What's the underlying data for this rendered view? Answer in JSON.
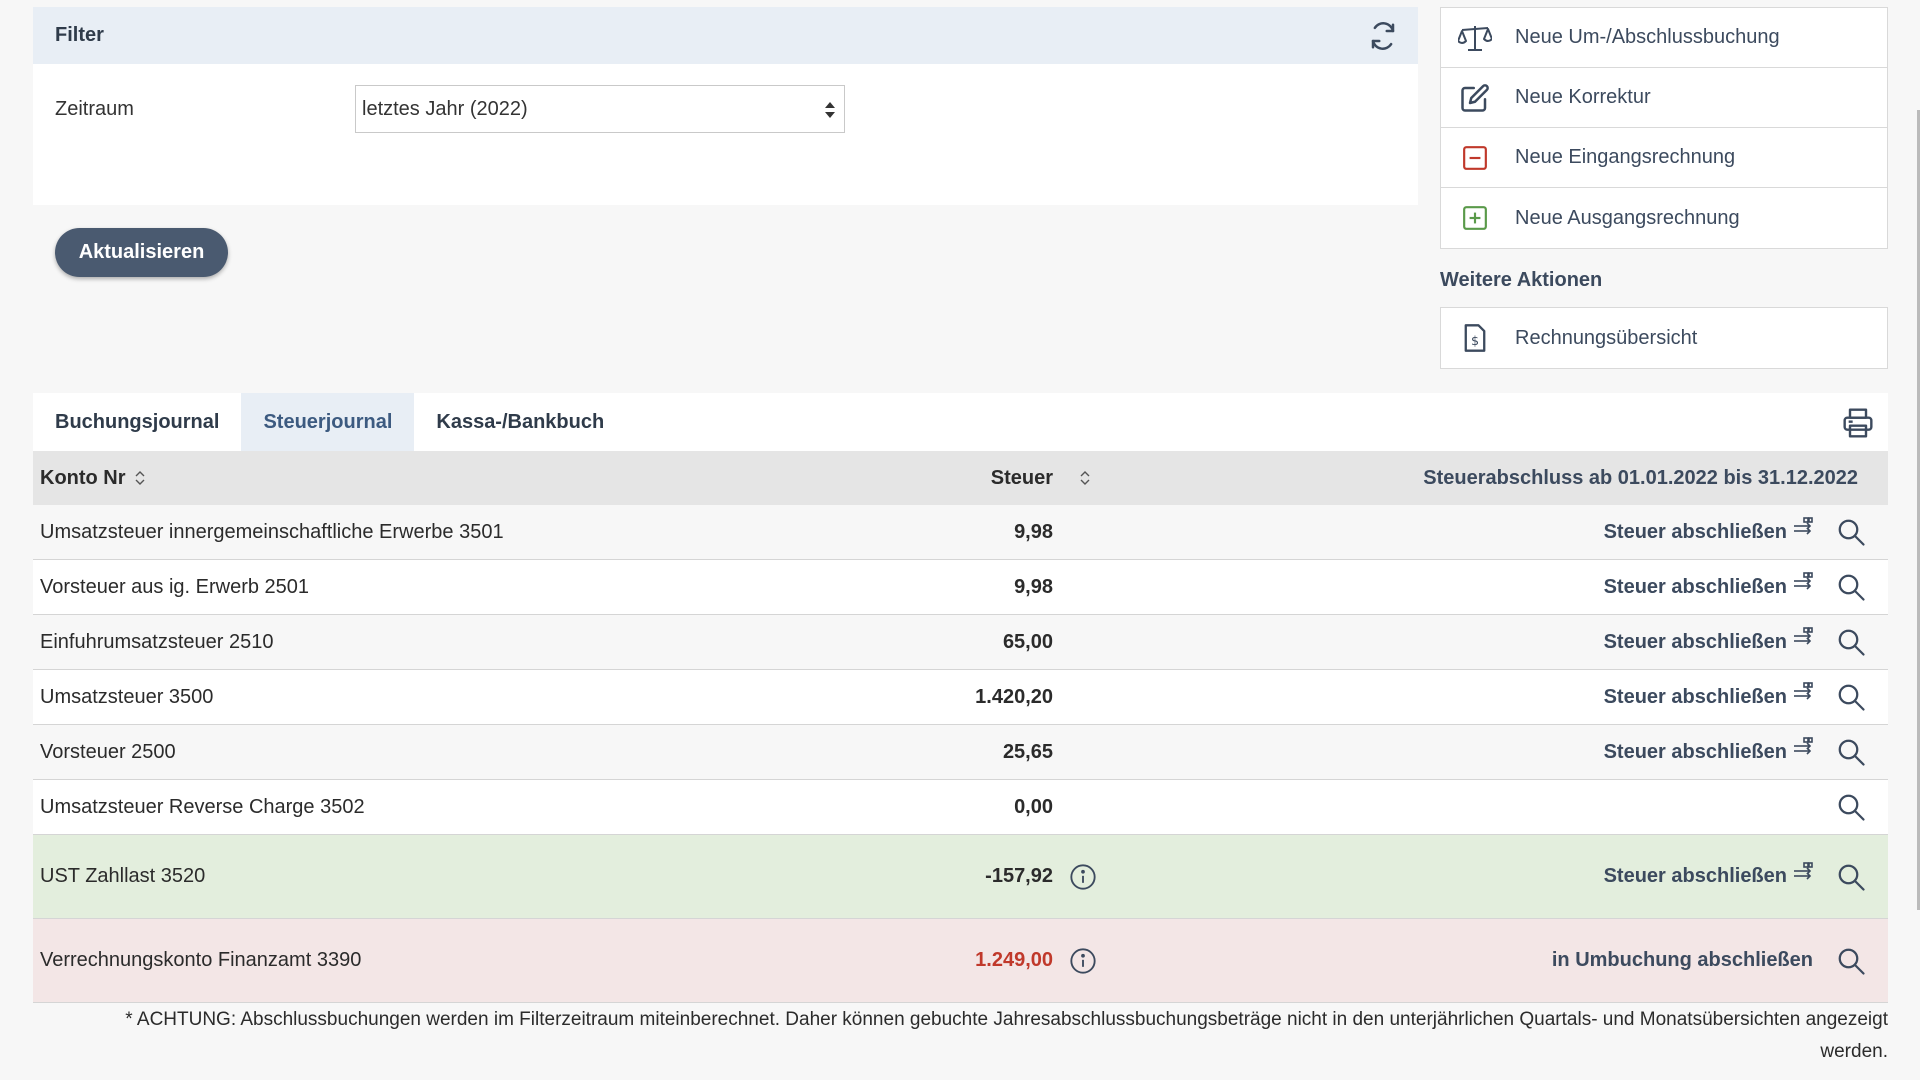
{
  "filter": {
    "title": "Filter",
    "period_label": "Zeitraum",
    "period_value": "letztes Jahr (2022)",
    "update_label": "Aktualisieren"
  },
  "actions": {
    "items": [
      {
        "label": "Neue Um-/Abschlussbuchung",
        "icon": "scale-icon"
      },
      {
        "label": "Neue Korrektur",
        "icon": "edit-icon"
      },
      {
        "label": "Neue Eingangsrechnung",
        "icon": "minus-box-icon"
      },
      {
        "label": "Neue Ausgangsrechnung",
        "icon": "plus-box-icon"
      }
    ],
    "more_title": "Weitere Aktionen",
    "more_items": [
      {
        "label": "Rechnungsübersicht",
        "icon": "invoice-icon"
      }
    ]
  },
  "tabs": [
    {
      "label": "Buchungsjournal",
      "active": false
    },
    {
      "label": "Steuerjournal",
      "active": true
    },
    {
      "label": "Kassa-/Bankbuch",
      "active": false
    }
  ],
  "table": {
    "headers": {
      "konto": "Konto Nr",
      "steuer": "Steuer",
      "abschluss": "Steuerabschluss ab 01.01.2022 bis 31.12.2022"
    },
    "rows": [
      {
        "konto": "Umsatzsteuer innergemeinschaftliche Erwerbe 3501",
        "steuer": "9,98",
        "action": "Steuer abschließen"
      },
      {
        "konto": "Vorsteuer aus ig. Erwerb 2501",
        "steuer": "9,98",
        "action": "Steuer abschließen"
      },
      {
        "konto": "Einfuhrumsatzsteuer 2510",
        "steuer": "65,00",
        "action": "Steuer abschließen"
      },
      {
        "konto": "Umsatzsteuer 3500",
        "steuer": "1.420,20",
        "action": "Steuer abschließen"
      },
      {
        "konto": "Vorsteuer 2500",
        "steuer": "25,65",
        "action": "Steuer abschließen"
      },
      {
        "konto": "Umsatzsteuer Reverse Charge 3502",
        "steuer": "0,00",
        "action": ""
      }
    ],
    "zahllast": {
      "konto": "UST Zahllast 3520",
      "steuer": "-157,92",
      "action": "Steuer abschließen"
    },
    "verrechnung": {
      "konto": "Verrechnungskonto Finanzamt 3390",
      "steuer": "1.249,00",
      "action": "in Umbuchung abschließen"
    }
  },
  "footnote": "* ACHTUNG: Abschlussbuchungen werden im Filterzeitraum miteinberechnet. Daher können gebuchte Jahresabschlussbuchungsbeträge nicht in den unterjährlichen Quartals- und Monatsübersichten angezeigt werden.",
  "colors": {
    "accent": "#4a5a70",
    "tab_active_bg": "#e8eef5",
    "green_row": "#e3eedd",
    "red_row": "#f3e6e6",
    "negative_red": "#c0392b"
  }
}
